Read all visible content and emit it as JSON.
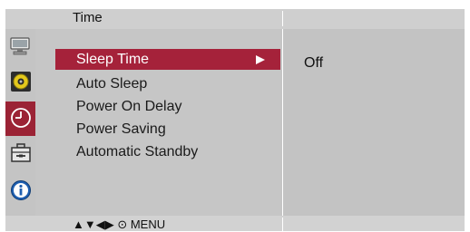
{
  "header": {
    "title": "Time"
  },
  "sidebar": {
    "icons": [
      {
        "name": "monitor-icon",
        "active": false
      },
      {
        "name": "audio-icon",
        "active": false
      },
      {
        "name": "clock-icon",
        "active": true
      },
      {
        "name": "toolbox-icon",
        "active": false
      },
      {
        "name": "info-icon",
        "active": false
      }
    ]
  },
  "menu": {
    "items": [
      {
        "label": "Sleep Time",
        "selected": true
      },
      {
        "label": "Auto Sleep",
        "selected": false
      },
      {
        "label": "Power On Delay",
        "selected": false
      },
      {
        "label": "Power Saving",
        "selected": false
      },
      {
        "label": "Automatic Standby",
        "selected": false
      }
    ]
  },
  "value_panel": {
    "value": "Off"
  },
  "footer": {
    "hint": "▲▼◀▶ ⊙ MENU"
  },
  "colors": {
    "accent": "#a5223a",
    "panel": "#c6c6c6"
  }
}
